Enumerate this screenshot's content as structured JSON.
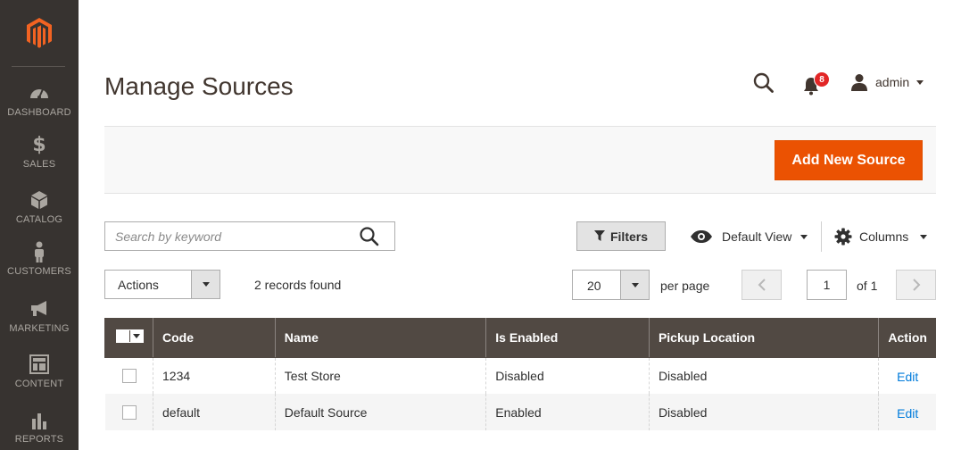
{
  "sidebar": {
    "logo": "magento-logo",
    "items": [
      {
        "label": "DASHBOARD",
        "icon": "dashboard-icon"
      },
      {
        "label": "SALES",
        "icon": "dollar-icon"
      },
      {
        "label": "CATALOG",
        "icon": "box-icon"
      },
      {
        "label": "CUSTOMERS",
        "icon": "person-icon"
      },
      {
        "label": "MARKETING",
        "icon": "megaphone-icon"
      },
      {
        "label": "CONTENT",
        "icon": "layout-icon"
      },
      {
        "label": "REPORTS",
        "icon": "bar-chart-icon"
      }
    ]
  },
  "header": {
    "title": "Manage Sources",
    "notifications_count": "8",
    "user_name": "admin"
  },
  "action_bar": {
    "add_button_label": "Add New Source"
  },
  "toolbar": {
    "search_placeholder": "Search by keyword",
    "filters_label": "Filters",
    "view_label": "Default View",
    "columns_label": "Columns",
    "actions_label": "Actions",
    "records_found": "2 records found",
    "per_page_value": "20",
    "per_page_label": "per page",
    "current_page": "1",
    "of_pages": "of 1"
  },
  "table": {
    "columns": [
      "Code",
      "Name",
      "Is Enabled",
      "Pickup Location",
      "Action"
    ],
    "rows": [
      {
        "code": "1234",
        "name": "Test Store",
        "is_enabled": "Disabled",
        "pickup_location": "Disabled",
        "action": "Edit"
      },
      {
        "code": "default",
        "name": "Default Source",
        "is_enabled": "Enabled",
        "pickup_location": "Disabled",
        "action": "Edit"
      }
    ]
  },
  "colors": {
    "sidebar_bg": "#373330",
    "accent": "#eb5202",
    "table_header_bg": "#514943",
    "link": "#007bdb",
    "badge": "#e22626"
  }
}
